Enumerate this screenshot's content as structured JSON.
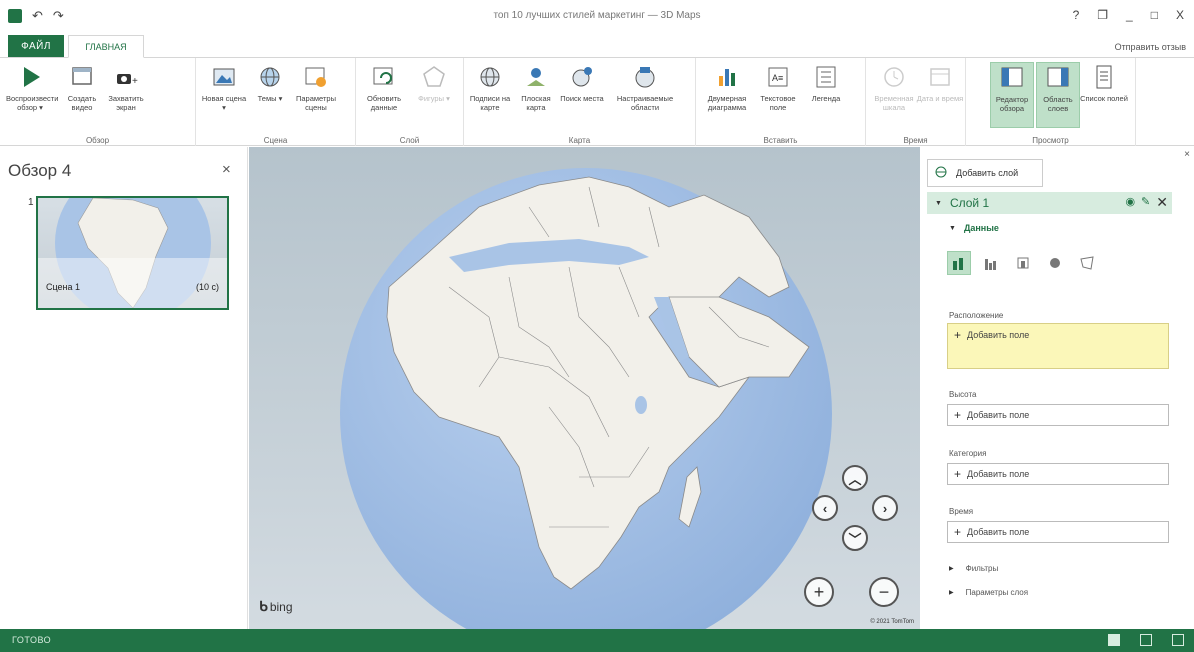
{
  "window": {
    "title": "топ 10 лучших стилей маркетинг — 3D Maps",
    "help_glyph": "?",
    "min_glyph": "_",
    "restore_glyph": "❐",
    "close_glyph": "X",
    "undo_glyph": "↶",
    "redo_glyph": "↷"
  },
  "tabs": {
    "file": "ФАЙЛ",
    "home": "ГЛАВНАЯ",
    "send_feedback": "Отправить отзыв"
  },
  "ribbon": {
    "groups": {
      "tour": "Обзор",
      "scene": "Сцена",
      "layer": "Слой",
      "map": "Карта",
      "insert": "Вставить",
      "time": "Время",
      "view": "Просмотр"
    },
    "buttons": {
      "play_tour": "Воспроизвести обзор ▾",
      "create_video": "Создать видео",
      "capture_screen": "Захватить экран",
      "new_scene": "Новая сцена ▾",
      "themes": "Темы ▾",
      "scene_options": "Параметры сцены",
      "refresh_data": "Обновить данные",
      "shapes": "Фигуры ▾",
      "map_labels": "Подписи на карте",
      "flat_map": "Плоская карта",
      "find_location": "Поиск места",
      "custom_regions": "Настраиваемые области",
      "2d_chart": "Двумерная диаграмма",
      "text_box": "Текстовое поле",
      "legend": "Легенда",
      "timeline": "Временная шкала",
      "date_time": "Дата и время",
      "tour_editor": "Редактор обзора",
      "layer_pane": "Область слоев",
      "field_list": "Список полей"
    }
  },
  "tour_panel": {
    "title": "Обзор 4",
    "close_glyph": "×",
    "scene_number": "1",
    "scene_name": "Сцена 1",
    "scene_duration": "(10 с)"
  },
  "map": {
    "bing": "bing",
    "copyright": "© 2021 TomTom",
    "nav": {
      "up": "︿",
      "down": "﹀",
      "left": "‹",
      "right": "›",
      "zoom_in": "+",
      "zoom_out": "−"
    }
  },
  "layer_pane": {
    "close_glyph": "×",
    "add_layer": "Добавить слой",
    "layer_name": "Слой 1",
    "data_section": "Данные",
    "location_label": "Расположение",
    "location_add": "Добавить поле",
    "height_label": "Высота",
    "height_add": "Добавить поле",
    "category_label": "Категория",
    "category_add": "Добавить поле",
    "time_label": "Время",
    "time_add": "Добавить поле",
    "filters": "Фильтры",
    "layer_options": "Параметры слоя"
  },
  "status": {
    "text": "ГОТОВО"
  },
  "colors": {
    "accent": "#217346",
    "ocean": "#a9c4e6",
    "land": "#f2f0ea",
    "highlight": "#fbf7b9"
  }
}
